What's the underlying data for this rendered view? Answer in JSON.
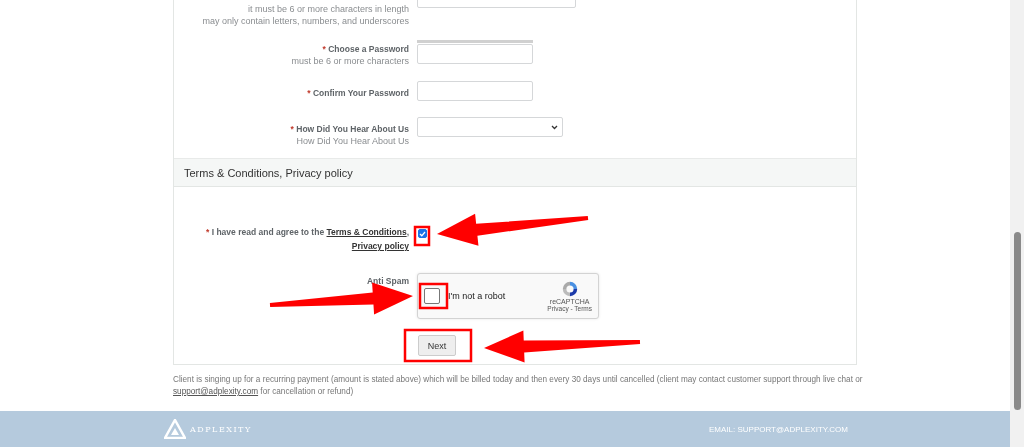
{
  "required_mark": "*",
  "account_fields": [
    {
      "kind": "text",
      "hints": [
        "it must be 6 or more characters in length",
        "may only contain letters, numbers, and underscores"
      ]
    },
    {
      "label": "Choose a Password",
      "required": true,
      "kind": "password",
      "meter": {
        "level": 0
      },
      "hints": [
        "must be 6 or more characters"
      ]
    },
    {
      "label": "Confirm Your Password",
      "required": true,
      "kind": "password"
    },
    {
      "label": "How Did You Hear About Us",
      "required": true,
      "kind": "select",
      "hints": [
        "How Did You Hear About Us"
      ]
    }
  ],
  "terms_section": {
    "title": "Terms & Conditions, Privacy policy",
    "agree": {
      "required": true,
      "text": "I have read and agree to the",
      "links": [
        "Terms & Conditions",
        "Privacy policy"
      ],
      "separator": ",",
      "checked": true
    },
    "anti_spam": {
      "label": "Anti Spam",
      "captcha_text": "I'm not a robot",
      "checked": false,
      "brand": "reCAPTCHA",
      "links": "Privacy - Terms"
    },
    "submit": "Next"
  },
  "disclaimer": {
    "text": "Client is singing up for a recurring payment (amount is stated above) which will be billed today and then every 30 days until cancelled (client may contact customer support through live chat or",
    "link": "support@adplexity.com",
    "tail": "for cancellation or refund)"
  },
  "footer": {
    "logo": "ADPLEXITY",
    "email": "EMAIL: SUPPORT@ADPLEXITY.COM"
  }
}
